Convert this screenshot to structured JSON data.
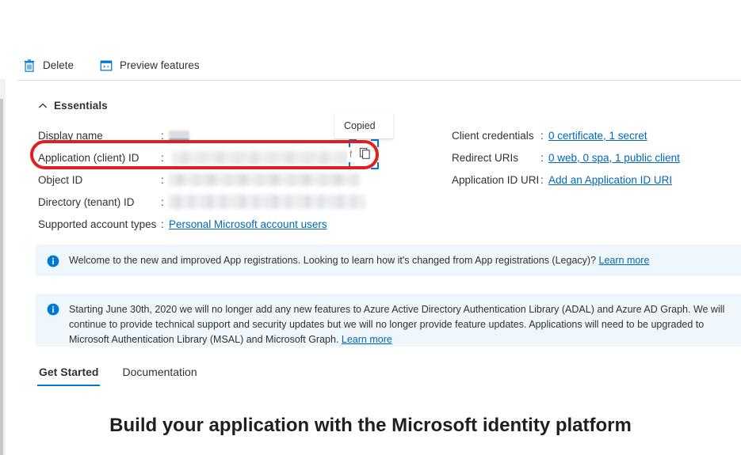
{
  "commandbar": {
    "buttons": [
      {
        "label": "Delete",
        "icon": "trash-icon"
      },
      {
        "label": "Preview features",
        "icon": "preview-features-icon"
      }
    ]
  },
  "essentials": {
    "title": "Essentials",
    "collapse_icon": "chevron-up-icon",
    "separator": ":",
    "left_rows": [
      {
        "label": "Display name",
        "value": "",
        "redacted": true,
        "link": false
      },
      {
        "label": "Application (client) ID",
        "value": "",
        "redacted": true,
        "link": false
      },
      {
        "label": "Object ID",
        "value": "",
        "redacted": true,
        "link": false
      },
      {
        "label": "Directory (tenant) ID",
        "value": "",
        "redacted": true,
        "link": false
      },
      {
        "label": "Supported account types",
        "value": "Personal Microsoft account users",
        "redacted": false,
        "link": true
      }
    ],
    "right_rows": [
      {
        "label": "Client credentials",
        "value": "0 certificate, 1 secret",
        "link": true
      },
      {
        "label": "Redirect URIs",
        "value": "0 web, 0 spa, 1 public client",
        "link": true
      },
      {
        "label": "Application ID URI",
        "value": "Add an Application ID URI",
        "link": true
      }
    ],
    "copy_button": {
      "icon": "copy-icon",
      "tooltip": "Copied"
    }
  },
  "banners": [
    {
      "icon": "info-icon",
      "text": "Welcome to the new and improved App registrations. Looking to learn how it's changed from App registrations (Legacy)? ",
      "link": "Learn more"
    },
    {
      "icon": "info-icon",
      "text": "Starting June 30th, 2020 we will no longer add any new features to Azure Active Directory Authentication Library (ADAL) and Azure AD Graph. We will continue to provide technical support and security updates but we will no longer provide feature updates. Applications will need to be upgraded to Microsoft Authentication Library (MSAL) and Microsoft Graph. ",
      "link": "Learn more"
    }
  ],
  "tabs": [
    {
      "label": "Get Started",
      "active": true
    },
    {
      "label": "Documentation",
      "active": false
    }
  ],
  "hero": {
    "heading": "Build your application with the Microsoft identity platform"
  },
  "colors": {
    "accent": "#0078d4",
    "link": "#0067b8",
    "banner_bg": "#eff6fc",
    "annotation_red": "#e02020",
    "text": "#323130"
  }
}
